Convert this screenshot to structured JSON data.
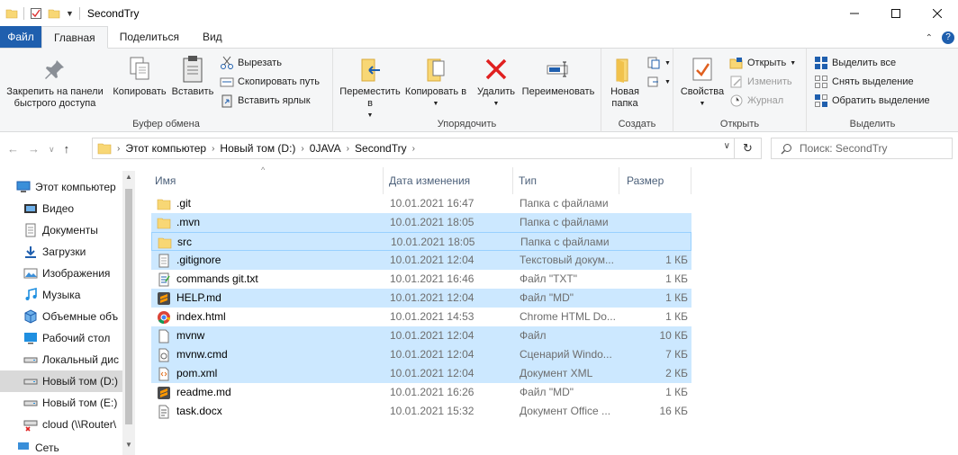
{
  "window": {
    "title": "SecondTry",
    "controls": [
      "minimize",
      "maximize",
      "close"
    ]
  },
  "tabs": [
    {
      "label": "Файл"
    },
    {
      "label": "Главная"
    },
    {
      "label": "Поделиться"
    },
    {
      "label": "Вид"
    }
  ],
  "ribbon": {
    "clipboard": {
      "label": "Буфер обмена",
      "pin": "Закрепить на панели быстрого доступа",
      "copy": "Копировать",
      "paste": "Вставить",
      "cut": "Вырезать",
      "copy_path": "Скопировать путь",
      "paste_shortcut": "Вставить ярлык"
    },
    "organize": {
      "label": "Упорядочить",
      "move_to": "Переместить в",
      "copy_to": "Копировать в",
      "delete": "Удалить",
      "rename": "Переименовать"
    },
    "create": {
      "label": "Создать",
      "new_folder": "Новая папка"
    },
    "open": {
      "label": "Открыть",
      "properties": "Свойства",
      "open": "Открыть",
      "edit": "Изменить",
      "history": "Журнал"
    },
    "select": {
      "label": "Выделить",
      "select_all": "Выделить все",
      "select_none": "Снять выделение",
      "invert": "Обратить выделение"
    }
  },
  "address": {
    "crumbs": [
      "Этот компьютер",
      "Новый том (D:)",
      "0JAVA",
      "SecondTry"
    ],
    "search_placeholder": "Поиск: SecondTry"
  },
  "nav": {
    "items": [
      {
        "label": "Этот компьютер",
        "icon": "pc-icon"
      },
      {
        "label": "Видео",
        "icon": "video-icon"
      },
      {
        "label": "Документы",
        "icon": "documents-icon"
      },
      {
        "label": "Загрузки",
        "icon": "downloads-icon"
      },
      {
        "label": "Изображения",
        "icon": "pictures-icon"
      },
      {
        "label": "Музыка",
        "icon": "music-icon"
      },
      {
        "label": "Объемные объ",
        "icon": "3d-objects-icon"
      },
      {
        "label": "Рабочий стол",
        "icon": "desktop-icon"
      },
      {
        "label": "Локальный дис",
        "icon": "drive-icon"
      },
      {
        "label": "Новый том (D:)",
        "icon": "drive-icon"
      },
      {
        "label": "Новый том (E:)",
        "icon": "drive-icon"
      },
      {
        "label": "cloud (\\\\Router\\",
        "icon": "network-drive-icon"
      },
      {
        "label": "Сеть",
        "icon": "network-icon"
      }
    ]
  },
  "columns": {
    "name": "Имя",
    "date": "Дата изменения",
    "type": "Тип",
    "size": "Размер"
  },
  "files": [
    {
      "name": ".git",
      "date": "10.01.2021 16:47",
      "type": "Папка с файлами",
      "size": "",
      "icon": "folder-icon"
    },
    {
      "name": ".mvn",
      "date": "10.01.2021 18:05",
      "type": "Папка с файлами",
      "size": "",
      "icon": "folder-icon"
    },
    {
      "name": "src",
      "date": "10.01.2021 18:05",
      "type": "Папка с файлами",
      "size": "",
      "icon": "folder-icon"
    },
    {
      "name": ".gitignore",
      "date": "10.01.2021 12:04",
      "type": "Текстовый докум...",
      "size": "1 КБ",
      "icon": "text-file-icon"
    },
    {
      "name": "commands git.txt",
      "date": "10.01.2021 16:46",
      "type": "Файл \"TXT\"",
      "size": "1 КБ",
      "icon": "txt-file-icon"
    },
    {
      "name": "HELP.md",
      "date": "10.01.2021 12:04",
      "type": "Файл \"MD\"",
      "size": "1 КБ",
      "icon": "sublime-file-icon"
    },
    {
      "name": "index.html",
      "date": "10.01.2021 14:53",
      "type": "Chrome HTML Do...",
      "size": "1 КБ",
      "icon": "chrome-file-icon"
    },
    {
      "name": "mvnw",
      "date": "10.01.2021 12:04",
      "type": "Файл",
      "size": "10 КБ",
      "icon": "generic-file-icon"
    },
    {
      "name": "mvnw.cmd",
      "date": "10.01.2021 12:04",
      "type": "Сценарий Windo...",
      "size": "7 КБ",
      "icon": "cmd-file-icon"
    },
    {
      "name": "pom.xml",
      "date": "10.01.2021 12:04",
      "type": "Документ XML",
      "size": "2 КБ",
      "icon": "xml-file-icon"
    },
    {
      "name": "readme.md",
      "date": "10.01.2021 16:26",
      "type": "Файл \"MD\"",
      "size": "1 КБ",
      "icon": "sublime-file-icon"
    },
    {
      "name": "task.docx",
      "date": "10.01.2021 15:32",
      "type": "Документ Office ...",
      "size": "16 КБ",
      "icon": "docx-file-icon"
    }
  ],
  "selection": {
    "selected_rows": [
      1,
      2,
      3,
      5,
      7,
      8,
      9
    ],
    "focused_row": 2,
    "selected_nav": 9
  },
  "colors": {
    "accent": "#1f5fae",
    "selection": "#cce8ff",
    "folder": "#f8d775"
  }
}
